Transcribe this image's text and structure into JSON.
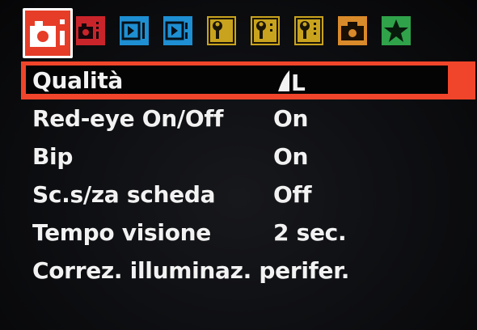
{
  "tabs": [
    {
      "name": "shooting-1",
      "icon": "camera-icon",
      "color": "#e8402a",
      "active": true
    },
    {
      "name": "shooting-2",
      "icon": "camera-icon",
      "color": "#c8262a"
    },
    {
      "name": "playback-1",
      "icon": "playback-icon",
      "color": "#1e8fd0"
    },
    {
      "name": "playback-2",
      "icon": "playback-icon",
      "color": "#1e8fd0"
    },
    {
      "name": "setup-1",
      "icon": "wrench-icon",
      "color": "#c8a21e"
    },
    {
      "name": "setup-2",
      "icon": "wrench-icon",
      "color": "#c8a21e"
    },
    {
      "name": "setup-3",
      "icon": "wrench-icon",
      "color": "#c8a21e"
    },
    {
      "name": "custom-functions",
      "icon": "camera-settings-icon",
      "color": "#d9892a"
    },
    {
      "name": "my-menu",
      "icon": "star-icon",
      "color": "#2fa14a"
    }
  ],
  "menu": {
    "items": [
      {
        "label": "Qualità",
        "value": "",
        "value_icon": "quality-large-fine-icon"
      },
      {
        "label": "Red-eye On/Off",
        "value": "On"
      },
      {
        "label": "Bip",
        "value": "On"
      },
      {
        "label": "Sc.s/za scheda",
        "value": "Off"
      },
      {
        "label": "Tempo visione",
        "value": "2 sec."
      },
      {
        "label": "Correz. illuminaz. perifer.",
        "value": ""
      }
    ],
    "quality_letter": "L"
  },
  "colors": {
    "selection": "#f0452a",
    "background": "#0d0e11",
    "text": "#f2f2f2"
  }
}
